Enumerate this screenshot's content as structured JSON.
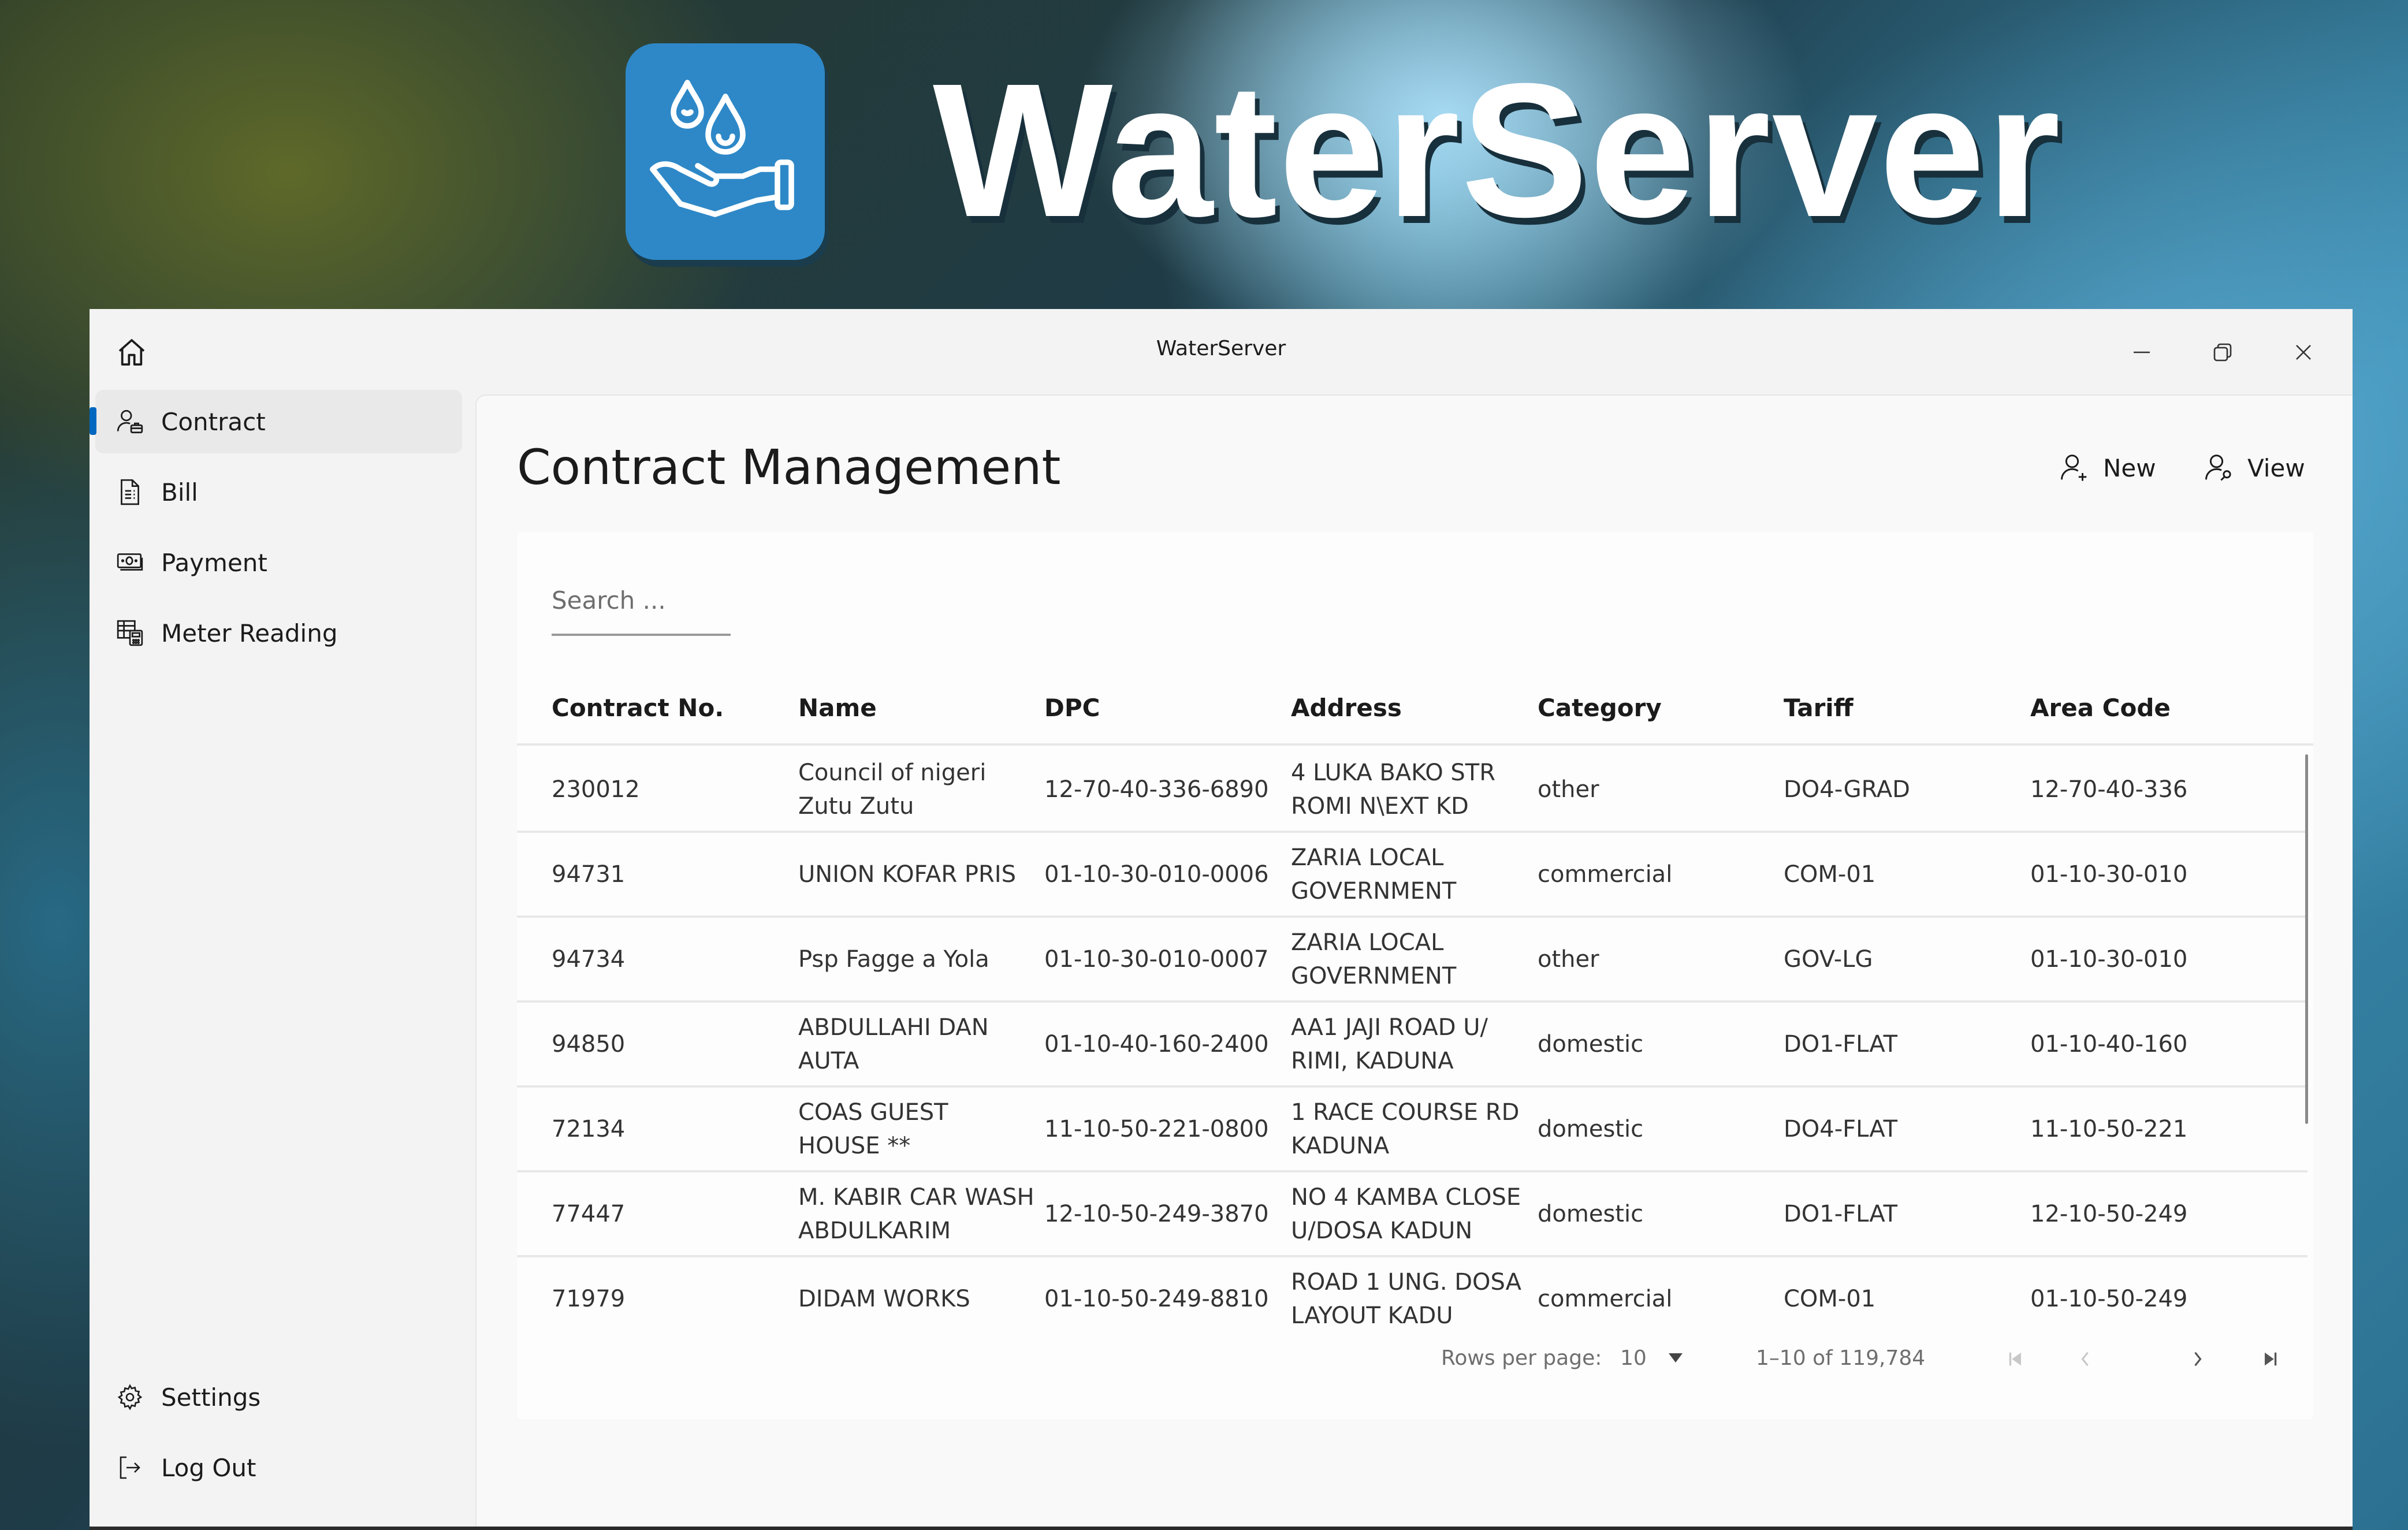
{
  "banner": {
    "brand_title": "WaterServer",
    "logo_icon": "hand-water-drops-icon",
    "logo_color": "#2e88c7"
  },
  "window": {
    "title": "WaterServer",
    "controls": {
      "minimize": "minimize-icon",
      "maximize": "restore-icon",
      "close": "close-icon"
    }
  },
  "sidebar": {
    "home_icon": "home-icon",
    "items": [
      {
        "label": "Contract",
        "icon": "person-briefcase-icon",
        "active": true
      },
      {
        "label": "Bill",
        "icon": "document-icon",
        "active": false
      },
      {
        "label": "Payment",
        "icon": "money-icon",
        "active": false
      },
      {
        "label": "Meter Reading",
        "icon": "calculator-table-icon",
        "active": false
      }
    ],
    "footer_items": [
      {
        "label": "Settings",
        "icon": "gear-icon"
      },
      {
        "label": "Log Out",
        "icon": "sign-out-icon"
      }
    ],
    "accent_color": "#0067c0"
  },
  "main": {
    "page_title": "Contract Management",
    "commands": [
      {
        "label": "New",
        "icon": "person-add-icon"
      },
      {
        "label": "View",
        "icon": "person-search-icon"
      }
    ],
    "search": {
      "placeholder": "Search ...",
      "value": ""
    },
    "table": {
      "columns": [
        "Contract No.",
        "Name",
        "DPC",
        "Address",
        "Category",
        "Tariff",
        "Area Code"
      ],
      "rows": [
        [
          "230012",
          "Council of nigeri Zutu Zutu",
          "12-70-40-336-6890",
          "4 LUKA BAKO STR ROMI N\\EXT KD",
          "other",
          "DO4-GRAD",
          "12-70-40-336"
        ],
        [
          "94731",
          "UNION KOFAR PRIS",
          "01-10-30-010-0006",
          "ZARIA LOCAL GOVERNMENT",
          "commercial",
          "COM-01",
          "01-10-30-010"
        ],
        [
          "94734",
          "Psp Fagge a Yola",
          "01-10-30-010-0007",
          "ZARIA LOCAL GOVERNMENT",
          "other",
          "GOV-LG",
          "01-10-30-010"
        ],
        [
          "94850",
          "ABDULLAHI DAN AUTA",
          "01-10-40-160-2400",
          "AA1 JAJI ROAD U/ RIMI, KADUNA",
          "domestic",
          "DO1-FLAT",
          "01-10-40-160"
        ],
        [
          "72134",
          "COAS GUEST HOUSE **",
          "11-10-50-221-0800",
          "1 RACE COURSE  RD KADUNA",
          "domestic",
          "DO4-FLAT",
          "11-10-50-221"
        ],
        [
          "77447",
          "M.  KABIR CAR WASH ABDULKARIM",
          "12-10-50-249-3870",
          "NO 4 KAMBA CLOSE U/DOSA KADUN",
          "domestic",
          "DO1-FLAT",
          "12-10-50-249"
        ],
        [
          "71979",
          "DIDAM WORKS",
          "01-10-50-249-8810",
          "ROAD 1 UNG. DOSA LAYOUT KADU",
          "commercial",
          "COM-01",
          "01-10-50-249"
        ]
      ]
    },
    "pagination": {
      "rows_per_page_label": "Rows per page:",
      "rows_per_page_value": "10",
      "range_text": "1–10 of 119,784",
      "buttons": [
        "first-page-icon",
        "previous-page-icon",
        "next-page-icon",
        "last-page-icon"
      ]
    }
  }
}
